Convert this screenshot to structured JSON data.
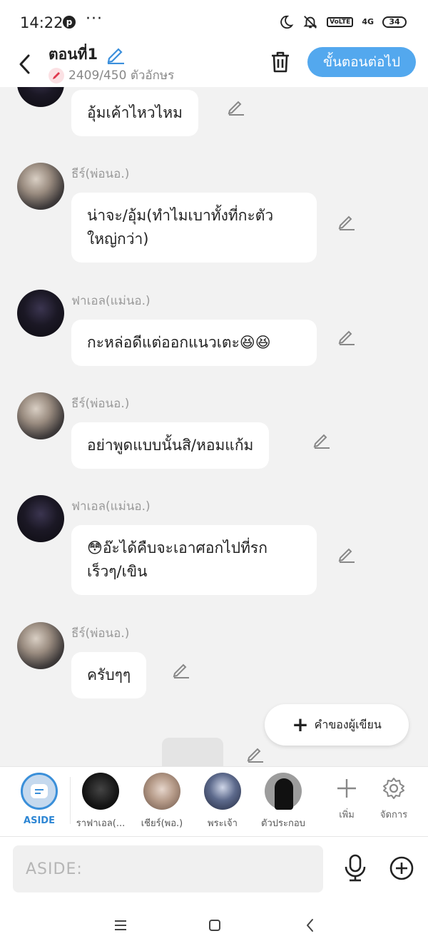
{
  "status_bar": {
    "time": "14:22",
    "dots": "···",
    "volte": "VoLTE",
    "network": "4G",
    "battery": "34"
  },
  "header": {
    "title": "ตอนที่1",
    "char_count": "2409/450 ตัวอักษร",
    "next_button": "ขั้นตอนต่อไป"
  },
  "messages": [
    {
      "speaker": "",
      "text": "อุ้มเค้าไหวไหม",
      "avatar": "fael"
    },
    {
      "speaker": "ธีร์(พ่อนอ.)",
      "text": "น่าจะ/อุ้ม(ทำไมเบาทั้งที่กะตัวใหญ่กว่า)",
      "avatar": "theer"
    },
    {
      "speaker": "ฟาเอล(แม่นอ.)",
      "text": "กะหล่อดีแต่ออกแนวเตะ😆😆",
      "avatar": "fael"
    },
    {
      "speaker": "ธีร์(พ่อนอ.)",
      "text": "อย่าพูดแบบนั้นสิ/หอมแก้ม",
      "avatar": "theer"
    },
    {
      "speaker": "ฟาเอล(แม่นอ.)",
      "text": "😳อ๊ะได้คืบจะเอาศอกไปที่รกเร็วๆ/เขิน",
      "avatar": "fael"
    },
    {
      "speaker": "ธีร์(พ่อนอ.)",
      "text": "ครับๆๆ",
      "avatar": "theer"
    }
  ],
  "author_button": {
    "label": "คำของผู้เขียน"
  },
  "characters": [
    {
      "name": "ASIDE"
    },
    {
      "name": "ราฟาเอล(..."
    },
    {
      "name": "เชียร์(พอ.)"
    },
    {
      "name": "พระเจ้า"
    },
    {
      "name": "ตัวประกอบ"
    }
  ],
  "tools": {
    "add": "เพิ่ม",
    "manage": "จัดการ"
  },
  "input": {
    "placeholder": "ASIDE:"
  },
  "colors": {
    "accent": "#53a8ee",
    "background": "#f2f2f2"
  }
}
